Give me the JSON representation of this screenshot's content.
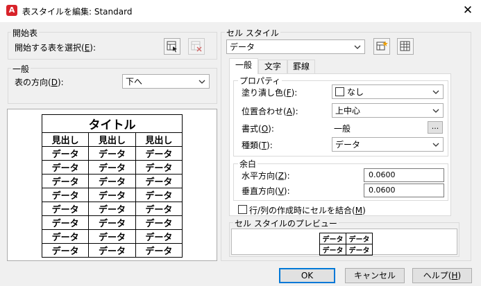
{
  "window": {
    "title": "表スタイルを編集: Standard",
    "app_icon_letter": "A"
  },
  "start_table": {
    "group_label": "開始表",
    "select_label": "開始する表を選択(",
    "select_key": "E",
    "select_suffix": "):"
  },
  "general": {
    "group_label": "一般",
    "direction_label": "表の方向(",
    "direction_key": "D",
    "direction_suffix": "):",
    "direction_value": "下へ"
  },
  "preview": {
    "title_cell": "タイトル",
    "headers": [
      "見出し",
      "見出し",
      "見出し"
    ],
    "rows": [
      [
        "データ",
        "データ",
        "データ"
      ],
      [
        "データ",
        "データ",
        "データ"
      ],
      [
        "データ",
        "データ",
        "データ"
      ],
      [
        "データ",
        "データ",
        "データ"
      ],
      [
        "データ",
        "データ",
        "データ"
      ],
      [
        "データ",
        "データ",
        "データ"
      ],
      [
        "データ",
        "データ",
        "データ"
      ],
      [
        "データ",
        "データ",
        "データ"
      ]
    ]
  },
  "cell_style": {
    "group_label": "セル スタイル",
    "selected": "データ",
    "tabs": [
      "一般",
      "文字",
      "罫線"
    ],
    "properties": {
      "group_label": "プロパティ",
      "fill_color_label": "塗り潰し色(",
      "fill_color_key": "F",
      "fill_color_value": "なし",
      "alignment_label": "位置合わせ(",
      "alignment_key": "A",
      "alignment_value": "上中心",
      "format_label": "書式(",
      "format_key": "O",
      "format_value": "一般",
      "format_button": "...",
      "type_label": "種類(",
      "type_key": "T",
      "type_value": "データ",
      "close_paren": "):"
    },
    "margins": {
      "group_label": "余白",
      "horizontal_label": "水平方向(",
      "horizontal_key": "Z",
      "horizontal_value": "0.0600",
      "vertical_label": "垂直方向(",
      "vertical_key": "V",
      "vertical_value": "0.0600",
      "close_paren": "):"
    },
    "merge_label": "行/列の作成時にセルを結合(",
    "merge_key": "M",
    "merge_suffix": ")",
    "preview_label": "セル スタイルのプレビュー",
    "preview_cells": [
      [
        "データ",
        "データ"
      ],
      [
        "データ",
        "データ"
      ]
    ]
  },
  "buttons": {
    "ok": "OK",
    "cancel": "キャンセル",
    "help": "ヘルプ(",
    "help_key": "H",
    "help_suffix": ")"
  }
}
